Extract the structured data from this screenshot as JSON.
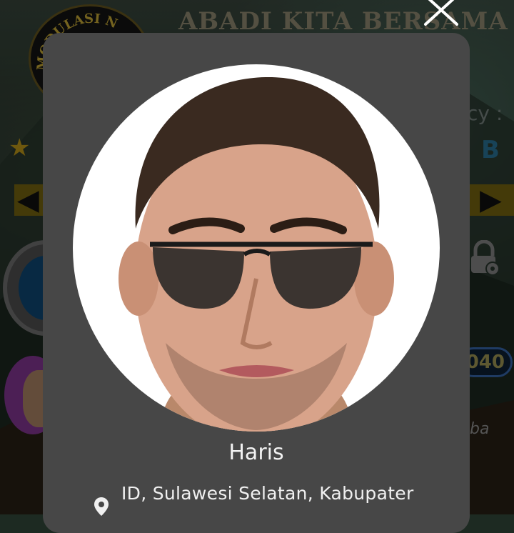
{
  "background": {
    "title": "ABADI KITA BERSAMA",
    "logo_text": "MODULASI N",
    "label_cy": "cy :",
    "letter_b": "B",
    "counter": "040",
    "partial_text": "ba",
    "icons": [
      "star-icon",
      "arrow-left-icon",
      "arrow-right-icon",
      "lock-icon",
      "avatar"
    ]
  },
  "modal": {
    "close_icon": "close-icon",
    "profile_name": "Haris",
    "location_icon": "location-pin-icon",
    "location": "ID, Sulawesi Selatan, Kabupater"
  },
  "colors": {
    "card": "#474747",
    "text": "#f2f2f2",
    "accent_gold": "#c9a11a"
  }
}
